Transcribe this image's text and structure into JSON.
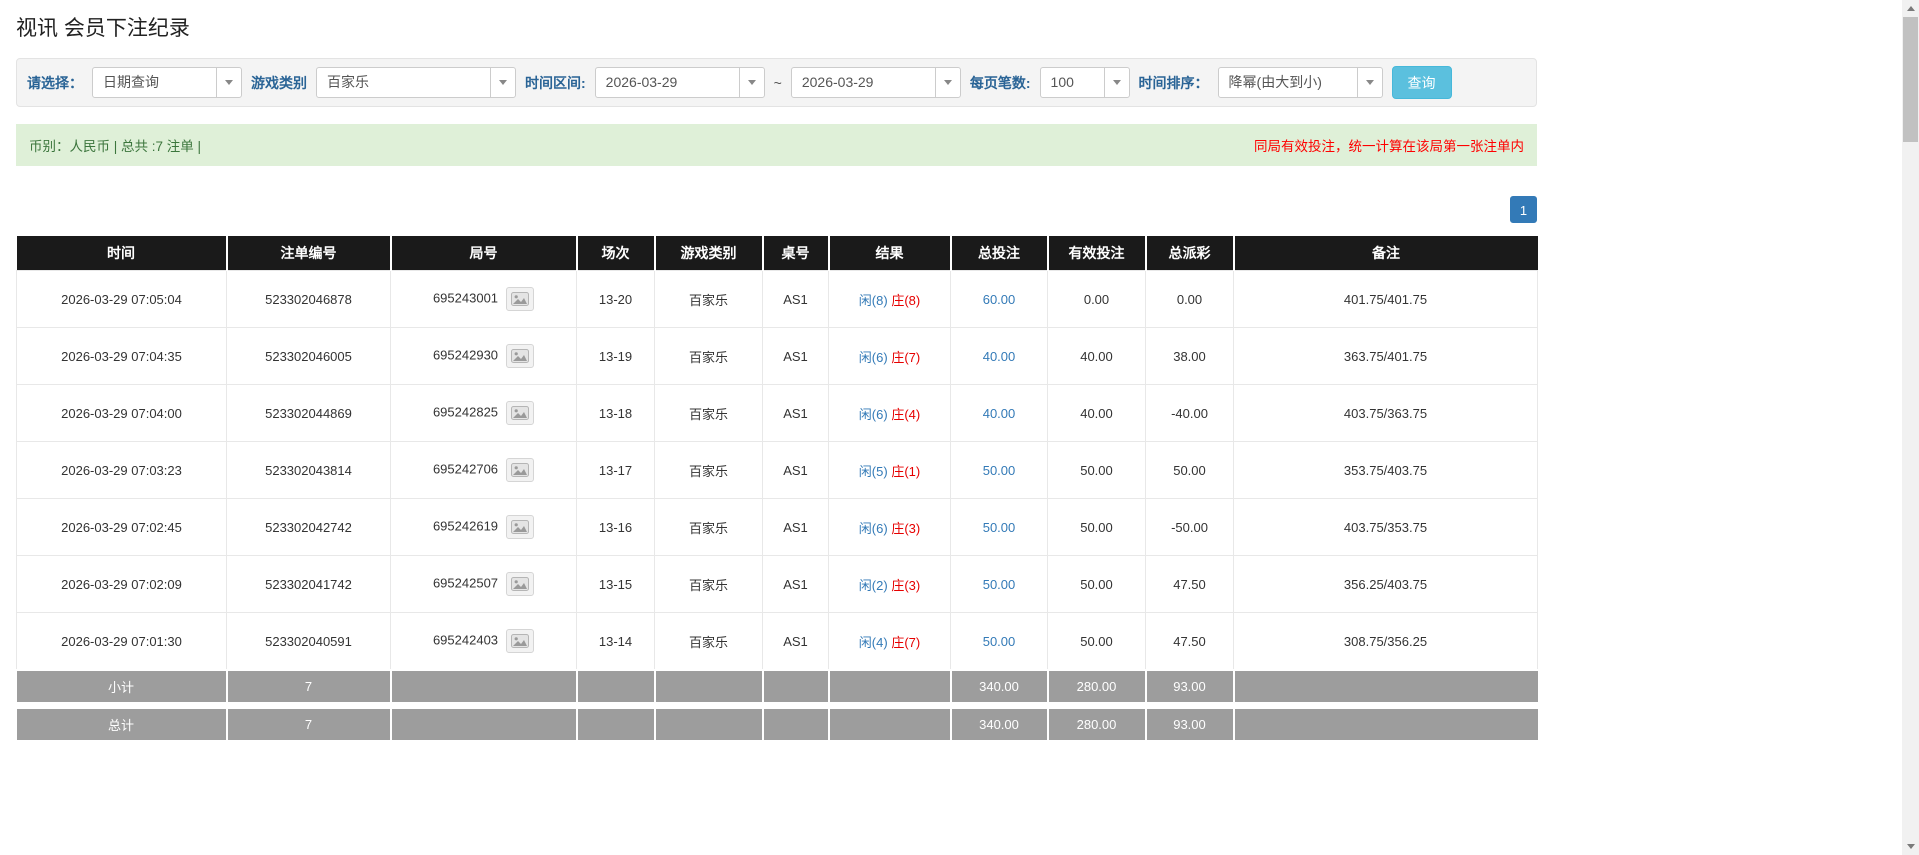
{
  "page_title": "视讯 会员下注纪录",
  "filter": {
    "select_label": "请选择：",
    "select_value": "日期查询",
    "game_type_label": "游戏类别",
    "game_type_value": "百家乐",
    "time_range_label": "时间区间:",
    "date_from": "2026-03-29",
    "tilde": "~",
    "date_to": "2026-03-29",
    "page_size_label": "每页笔数:",
    "page_size_value": "100",
    "sort_label": "时间排序：",
    "sort_value": "降幂(由大到小)",
    "search_button": "查询"
  },
  "info_bar": {
    "left_text": "币别：人民币 | 总共 :7 注单 |",
    "right_text": "同局有效投注，统一计算在该局第一张注单内"
  },
  "pagination": {
    "current": "1"
  },
  "colors": {
    "accent_blue": "#337ab7",
    "negative_red": "#e60000",
    "notice_red": "#ff0000",
    "info_green_text": "#3c763d",
    "info_bar_bg": "#dff0d8",
    "table_header_bg": "#1a1a1a",
    "summary_row_bg": "#9d9d9d",
    "search_button_bg": "#5bc0de"
  },
  "table": {
    "headers": [
      "时间",
      "注单编号",
      "局号",
      "场次",
      "游戏类别",
      "桌号",
      "结果",
      "总投注",
      "有效投注",
      "总派彩",
      "备注"
    ],
    "rows": [
      {
        "time": "2026-03-29 07:05:04",
        "bet_no": "523302046878",
        "round_no": "695243001",
        "session": "13-20",
        "game": "百家乐",
        "table_no": "AS1",
        "result_player": "闲(8)",
        "result_banker": "庄(8)",
        "total_bet": "60.00",
        "valid_bet": "0.00",
        "payout": "0.00",
        "note": "401.75/401.75"
      },
      {
        "time": "2026-03-29 07:04:35",
        "bet_no": "523302046005",
        "round_no": "695242930",
        "session": "13-19",
        "game": "百家乐",
        "table_no": "AS1",
        "result_player": "闲(6)",
        "result_banker": "庄(7)",
        "total_bet": "40.00",
        "valid_bet": "40.00",
        "payout": "38.00",
        "note": "363.75/401.75"
      },
      {
        "time": "2026-03-29 07:04:00",
        "bet_no": "523302044869",
        "round_no": "695242825",
        "session": "13-18",
        "game": "百家乐",
        "table_no": "AS1",
        "result_player": "闲(6)",
        "result_banker": "庄(4)",
        "total_bet": "40.00",
        "valid_bet": "40.00",
        "payout": "-40.00",
        "note": "403.75/363.75"
      },
      {
        "time": "2026-03-29 07:03:23",
        "bet_no": "523302043814",
        "round_no": "695242706",
        "session": "13-17",
        "game": "百家乐",
        "table_no": "AS1",
        "result_player": "闲(5)",
        "result_banker": "庄(1)",
        "total_bet": "50.00",
        "valid_bet": "50.00",
        "payout": "50.00",
        "note": "353.75/403.75"
      },
      {
        "time": "2026-03-29 07:02:45",
        "bet_no": "523302042742",
        "round_no": "695242619",
        "session": "13-16",
        "game": "百家乐",
        "table_no": "AS1",
        "result_player": "闲(6)",
        "result_banker": "庄(3)",
        "total_bet": "50.00",
        "valid_bet": "50.00",
        "payout": "-50.00",
        "note": "403.75/353.75"
      },
      {
        "time": "2026-03-29 07:02:09",
        "bet_no": "523302041742",
        "round_no": "695242507",
        "session": "13-15",
        "game": "百家乐",
        "table_no": "AS1",
        "result_player": "闲(2)",
        "result_banker": "庄(3)",
        "total_bet": "50.00",
        "valid_bet": "50.00",
        "payout": "47.50",
        "note": "356.25/403.75"
      },
      {
        "time": "2026-03-29 07:01:30",
        "bet_no": "523302040591",
        "round_no": "695242403",
        "session": "13-14",
        "game": "百家乐",
        "table_no": "AS1",
        "result_player": "闲(4)",
        "result_banker": "庄(7)",
        "total_bet": "50.00",
        "valid_bet": "50.00",
        "payout": "47.50",
        "note": "308.75/356.25"
      }
    ],
    "subtotal": {
      "label": "小计",
      "count": "7",
      "total_bet": "340.00",
      "valid_bet": "280.00",
      "payout": "93.00"
    },
    "total": {
      "label": "总计",
      "count": "7",
      "total_bet": "340.00",
      "valid_bet": "280.00",
      "payout": "93.00"
    }
  }
}
